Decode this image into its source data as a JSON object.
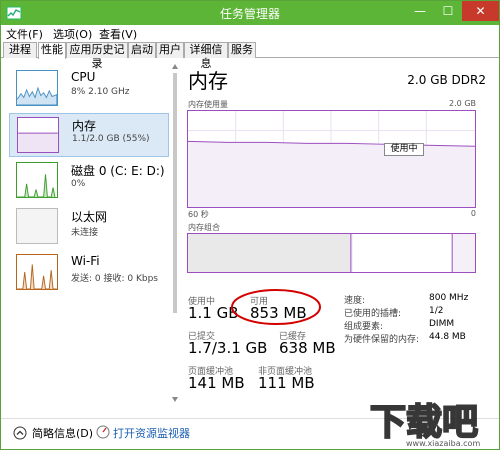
{
  "window": {
    "title": "任务管理器",
    "min": "—",
    "max": "☐",
    "close": "✕"
  },
  "menu": [
    "文件(F)",
    "选项(O)",
    "查看(V)"
  ],
  "tabs": [
    "进程",
    "性能",
    "应用历史记录",
    "启动",
    "用户",
    "详细信息",
    "服务"
  ],
  "sidebar": [
    {
      "name": "CPU",
      "sub": "8% 2.10 GHz"
    },
    {
      "name": "内存",
      "sub": "1.1/2.0 GB (55%)"
    },
    {
      "name": "磁盘 0 (C: E: D:)",
      "sub": "0%"
    },
    {
      "name": "以太网",
      "sub": "未连接"
    },
    {
      "name": "Wi-Fi",
      "sub": "发送: 0 接收: 0 Kbps"
    }
  ],
  "main": {
    "title": "内存",
    "subtitle": "2.0 GB DDR2",
    "usage_label": "内存使用量",
    "usage_max": "2.0 GB",
    "tooltip": "使用中",
    "time_left": "60 秒",
    "time_right": "0",
    "composition_label": "内存组合"
  },
  "stats": {
    "in_use_label": "使用中",
    "in_use": "1.1 GB",
    "avail_label": "可用",
    "avail": "853 MB",
    "committed_label": "已提交",
    "committed": "1.7/3.1 GB",
    "cached_label": "已缓存",
    "cached": "638 MB",
    "paged_label": "页面缓冲池",
    "paged": "141 MB",
    "nonpaged_label": "非页面缓冲池",
    "nonpaged": "111 MB"
  },
  "details": [
    {
      "label": "速度:",
      "value": "800 MHz"
    },
    {
      "label": "已使用的插槽:",
      "value": "1/2"
    },
    {
      "label": "组成要素:",
      "value": "DIMM"
    },
    {
      "label": "为硬件保留的内存:",
      "value": "44.8 MB"
    }
  ],
  "footer": {
    "summary": "简略信息(D)",
    "resmon": "打开资源监视器"
  },
  "colors": {
    "title_bar": "#5cb536",
    "memory_accent": "#9b4fbf",
    "cpu_accent": "#4a90c2",
    "disk_accent": "#3c9d2e",
    "wifi_accent": "#b5651d",
    "annotation_red": "#d40000"
  }
}
